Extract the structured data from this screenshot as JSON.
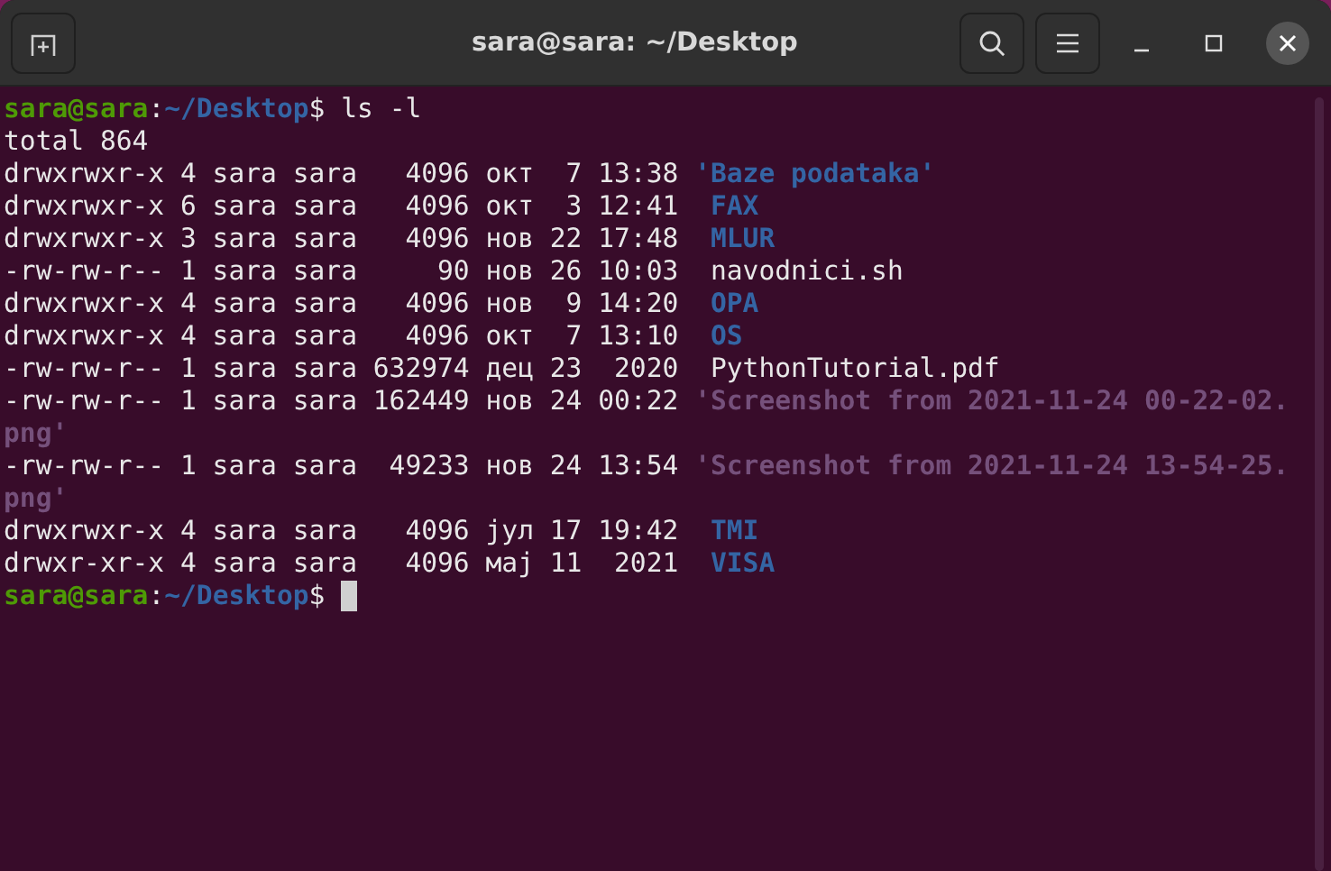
{
  "window": {
    "title": "sara@sara: ~/Desktop"
  },
  "terminal": {
    "lines": [
      {
        "kind": "prompt",
        "user": "sara@sara",
        "separator": ":",
        "path": "~/Desktop",
        "symbol": "$",
        "command": "ls -l"
      },
      {
        "kind": "output",
        "text": "total 864"
      },
      {
        "kind": "dir",
        "meta": "drwxrwxr-x 4 sara sara   4096 окт  7 13:38",
        "name": "'Baze podataka'",
        "aligned": false
      },
      {
        "kind": "dir",
        "meta": "drwxrwxr-x 6 sara sara   4096 окт  3 12:41",
        "name": "FAX",
        "aligned": true
      },
      {
        "kind": "dir",
        "meta": "drwxrwxr-x 3 sara sara   4096 нов 22 17:48",
        "name": "MLUR",
        "aligned": true
      },
      {
        "kind": "file",
        "meta": "-rw-rw-r-- 1 sara sara     90 нов 26 10:03",
        "name": "navodnici.sh",
        "aligned": true
      },
      {
        "kind": "dir",
        "meta": "drwxrwxr-x 4 sara sara   4096 нов  9 14:20",
        "name": "OPA",
        "aligned": true
      },
      {
        "kind": "dir",
        "meta": "drwxrwxr-x 4 sara sara   4096 окт  7 13:10",
        "name": "OS",
        "aligned": true
      },
      {
        "kind": "file",
        "meta": "-rw-rw-r-- 1 sara sara 632974 дец 23  2020",
        "name": "PythonTutorial.pdf",
        "aligned": true
      },
      {
        "kind": "image",
        "meta": "-rw-rw-r-- 1 sara sara 162449 нов 24 00:22",
        "name": "'Screenshot from 2021-11-24 00-22-02.",
        "aligned": false
      },
      {
        "kind": "image_wrap",
        "text": "png'"
      },
      {
        "kind": "image",
        "meta": "-rw-rw-r-- 1 sara sara  49233 нов 24 13:54",
        "name": "'Screenshot from 2021-11-24 13-54-25.",
        "aligned": false
      },
      {
        "kind": "image_wrap",
        "text": "png'"
      },
      {
        "kind": "dir",
        "meta": "drwxrwxr-x 4 sara sara   4096 јул 17 19:42",
        "name": "TMI",
        "aligned": true
      },
      {
        "kind": "dir",
        "meta": "drwxr-xr-x 4 sara sara   4096 мај 11  2021",
        "name": "VISA",
        "aligned": true
      },
      {
        "kind": "prompt",
        "user": "sara@sara",
        "separator": ":",
        "path": "~/Desktop",
        "symbol": "$",
        "cursor": true
      }
    ]
  }
}
